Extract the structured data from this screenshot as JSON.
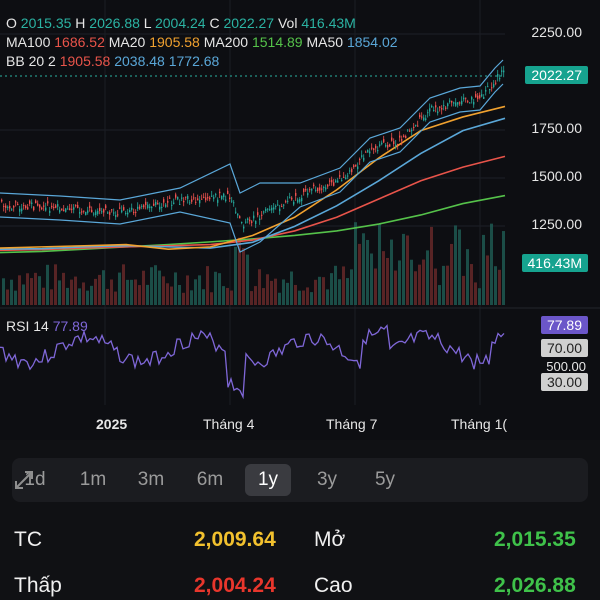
{
  "header": {
    "o_label": "O",
    "o_value": "2015.35",
    "h_label": "H",
    "h_value": "2026.88",
    "l_label": "L",
    "l_value": "2004.24",
    "c_label": "C",
    "c_value": "2022.27",
    "vol_label": "Vol",
    "vol_value": "416.43M",
    "ma100_label": "MA100",
    "ma100_value": "1686.52",
    "ma20_label": "MA20",
    "ma20_value": "1905.58",
    "ma200_label": "MA200",
    "ma200_value": "1514.89",
    "ma50_label": "MA50",
    "ma50_value": "1854.02",
    "bb_label": "BB 20 2",
    "bb_mid": "1905.58",
    "bb_upper": "2038.48",
    "bb_lower": "1772.68"
  },
  "price_axis": [
    "2250.00",
    "1750.00",
    "1500.00",
    "1250.00"
  ],
  "tags": {
    "last_price": "2022.27",
    "volume": "416.43M",
    "rsi_value": "77.89",
    "rsi_70": "70.00",
    "rsi_50": "500.00",
    "rsi_30": "30.00"
  },
  "rsi": {
    "label": "RSI 14",
    "value": "77.89"
  },
  "x_axis": [
    "2025",
    "Tháng 4",
    "Tháng 7",
    "Tháng 1("
  ],
  "periods": [
    "1d",
    "1m",
    "3m",
    "6m",
    "1y",
    "3y",
    "5y"
  ],
  "active_period": "1y",
  "stats": {
    "tc_label": "TC",
    "tc_value": "2,009.64",
    "mo_label": "Mở",
    "mo_value": "2,015.35",
    "thap_label": "Thấp",
    "thap_value": "2,004.24",
    "cao_label": "Cao",
    "cao_value": "2,026.88"
  },
  "colors": {
    "teal": "#2bb3a3",
    "red": "#e8544a",
    "orange": "#f0a12f",
    "green": "#55c24a",
    "blue": "#5aa7d8",
    "purple": "#7f67d8",
    "yellow": "#f2c12e"
  },
  "chart_data": {
    "type": "line",
    "title": "",
    "xlabel": "",
    "ylabel": "",
    "x_ticks": [
      "2025",
      "Tháng 4",
      "Tháng 7",
      "Tháng 1("
    ],
    "y_ticks": [
      1250,
      1500,
      1750,
      2250
    ],
    "ylim": [
      1100,
      2300
    ],
    "series": [
      {
        "name": "MA200",
        "values": [
          1265,
          1270,
          1280,
          1290,
          1300,
          1312,
          1325,
          1340,
          1360,
          1390,
          1430,
          1480,
          1515
        ]
      },
      {
        "name": "MA100",
        "values": [
          1275,
          1278,
          1285,
          1290,
          1295,
          1300,
          1320,
          1360,
          1420,
          1500,
          1580,
          1640,
          1687
        ]
      },
      {
        "name": "MA50",
        "values": [
          1280,
          1282,
          1290,
          1295,
          1290,
          1285,
          1310,
          1380,
          1470,
          1580,
          1700,
          1800,
          1854
        ]
      },
      {
        "name": "MA20",
        "values": [
          1285,
          1290,
          1295,
          1300,
          1280,
          1290,
          1340,
          1420,
          1540,
          1680,
          1800,
          1860,
          1906
        ]
      }
    ],
    "grid": true
  }
}
